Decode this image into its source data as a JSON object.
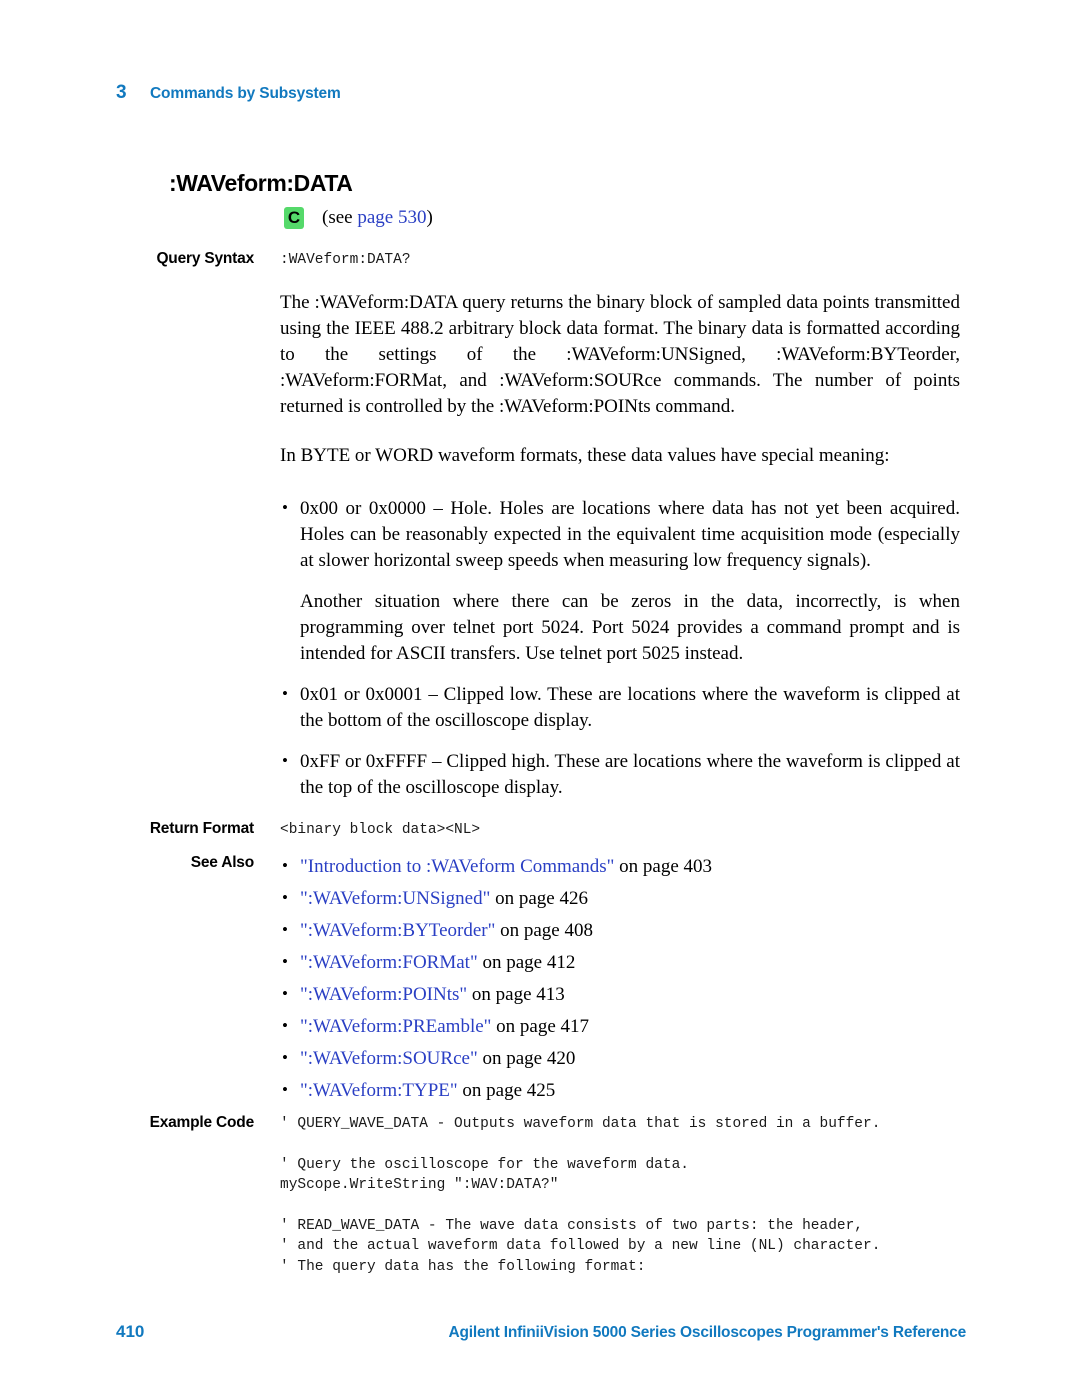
{
  "header": {
    "chapter_number": "3",
    "chapter_title": "Commands by Subsystem"
  },
  "command": {
    "title": ":WAVeform:DATA",
    "badge": "C",
    "see_prefix": "(see ",
    "see_link": "page  530",
    "see_suffix": ")"
  },
  "query_syntax": {
    "label": "Query Syntax",
    "value": ":WAVeform:DATA?"
  },
  "description": {
    "p1": "The :WAVeform:DATA query returns the binary block of sampled data points transmitted using the IEEE 488.2 arbitrary block data format. The binary data is formatted according to the settings of the :WAVeform:UNSigned, :WAVeform:BYTeorder, :WAVeform:FORMat, and :WAVeform:SOURce commands. The number of points returned is controlled by the :WAVeform:POINts command.",
    "p2": "In BYTE or WORD waveform formats, these data values have special meaning:",
    "bullets": [
      "0x00 or 0x0000 – Hole. Holes are locations where data has not yet been acquired. Holes can be reasonably expected in the equivalent time acquisition mode (especially at slower horizontal sweep speeds when measuring low frequency signals).",
      "0x01 or 0x0001 – Clipped low. These are locations where the waveform is clipped at the bottom of the oscilloscope display.",
      "0xFF or 0xFFFF – Clipped high. These are locations where the waveform is clipped at the top of the oscilloscope display."
    ],
    "bullet1_sub": "Another situation where there can be zeros in the data, incorrectly, is when programming over telnet port 5024. Port 5024 provides a command prompt and is intended for ASCII transfers. Use telnet port 5025 instead."
  },
  "return_format": {
    "label": "Return Format",
    "value": "<binary block data><NL>"
  },
  "see_also": {
    "label": "See Also",
    "items": [
      {
        "link": "\"Introduction to :WAVeform Commands\"",
        "suffix": " on page  403"
      },
      {
        "link": "\":WAVeform:UNSigned\"",
        "suffix": " on page  426"
      },
      {
        "link": "\":WAVeform:BYTeorder\"",
        "suffix": " on page  408"
      },
      {
        "link": "\":WAVeform:FORMat\"",
        "suffix": " on page  412"
      },
      {
        "link": "\":WAVeform:POINts\"",
        "suffix": " on page  413"
      },
      {
        "link": "\":WAVeform:PREamble\"",
        "suffix": " on page  417"
      },
      {
        "link": "\":WAVeform:SOURce\"",
        "suffix": " on page  420"
      },
      {
        "link": "\":WAVeform:TYPE\"",
        "suffix": " on page  425"
      }
    ]
  },
  "example_code": {
    "label": "Example Code",
    "block1": "' QUERY_WAVE_DATA - Outputs waveform data that is stored in a buffer.",
    "block2": "' Query the oscilloscope for the waveform data.\nmyScope.WriteString \":WAV:DATA?\"",
    "block3": "' READ_WAVE_DATA - The wave data consists of two parts: the header,\n' and the actual waveform data followed by a new line (NL) character.\n' The query data has the following format:"
  },
  "footer": {
    "page_number": "410",
    "book_title": "Agilent InfiniiVision 5000 Series Oscilloscopes Programmer's Reference"
  },
  "colors": {
    "header_blue": "#1179bf",
    "link_blue": "#2a3fc4",
    "badge_green": "#55d96a"
  }
}
